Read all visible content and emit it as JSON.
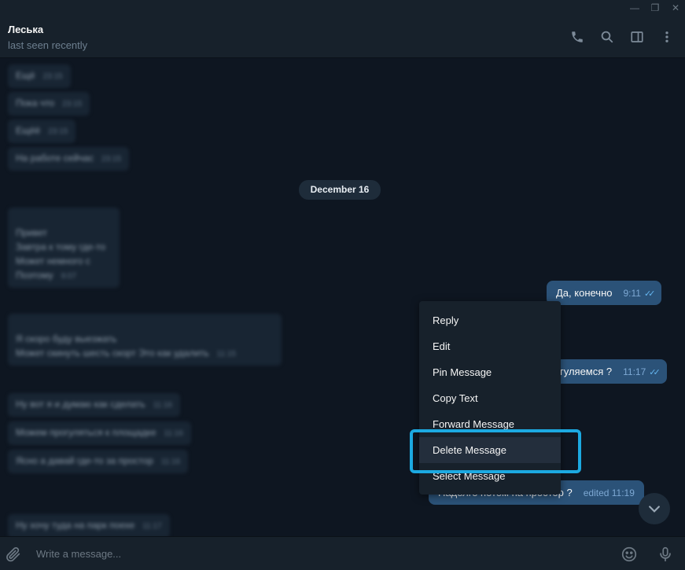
{
  "window": {
    "minimize_icon": "minimize-icon",
    "restore_icon": "restore-icon",
    "close_icon": "close-icon"
  },
  "header": {
    "name": "Леська",
    "status": "last seen recently",
    "icons": [
      "phone-icon",
      "search-icon",
      "sidebar-icon",
      "more-vert-icon"
    ]
  },
  "chat": {
    "date_separator": "December 16",
    "blurred_incoming": [
      {
        "text": "Ещё",
        "time": "23:15"
      },
      {
        "text": "Пока что",
        "time": "23:15"
      },
      {
        "text": "Ещёё",
        "time": "23:15"
      },
      {
        "text": "На работе сейчас",
        "time": "23:15"
      },
      {
        "text": "Привет\nЗавтра к тому где-то\nМожет немного с\nПоэтому",
        "time": "9:07"
      },
      {
        "text": "Я скоро буду выезжать\nМожет скинуть шесть скорт Это как удалить",
        "time": "11:15"
      },
      {
        "text": "Ну вот я и думаю как сделать",
        "time": "11:16"
      },
      {
        "text": "Можем прогуляться к площадке",
        "time": "11:16"
      },
      {
        "text": "Ясно а давай где-то за простор",
        "time": "11:16"
      },
      {
        "text": "Ну хочу туда на парк поехе",
        "time": "11:17"
      }
    ],
    "outgoing": [
      {
        "text": "Да, конечно",
        "time": "9:11",
        "read": true
      },
      {
        "text": "гуляемся ?",
        "time": "11:17",
        "read": true
      },
      {
        "text": "Надолго потом на простор ?",
        "time": "edited 11:19",
        "read": false
      }
    ]
  },
  "context_menu": {
    "items": [
      "Reply",
      "Edit",
      "Pin Message",
      "Copy Text",
      "Forward Message",
      "Delete Message",
      "Select Message"
    ],
    "highlighted": "Delete Message"
  },
  "composer": {
    "placeholder": "Write a message...",
    "icons": [
      "attach-icon",
      "emoji-icon",
      "microphone-icon"
    ]
  },
  "colors": {
    "accent": "#1ca9e1",
    "outgoing_bubble": "#2b5278",
    "incoming_bubble": "#182533",
    "background": "#0e1621"
  }
}
